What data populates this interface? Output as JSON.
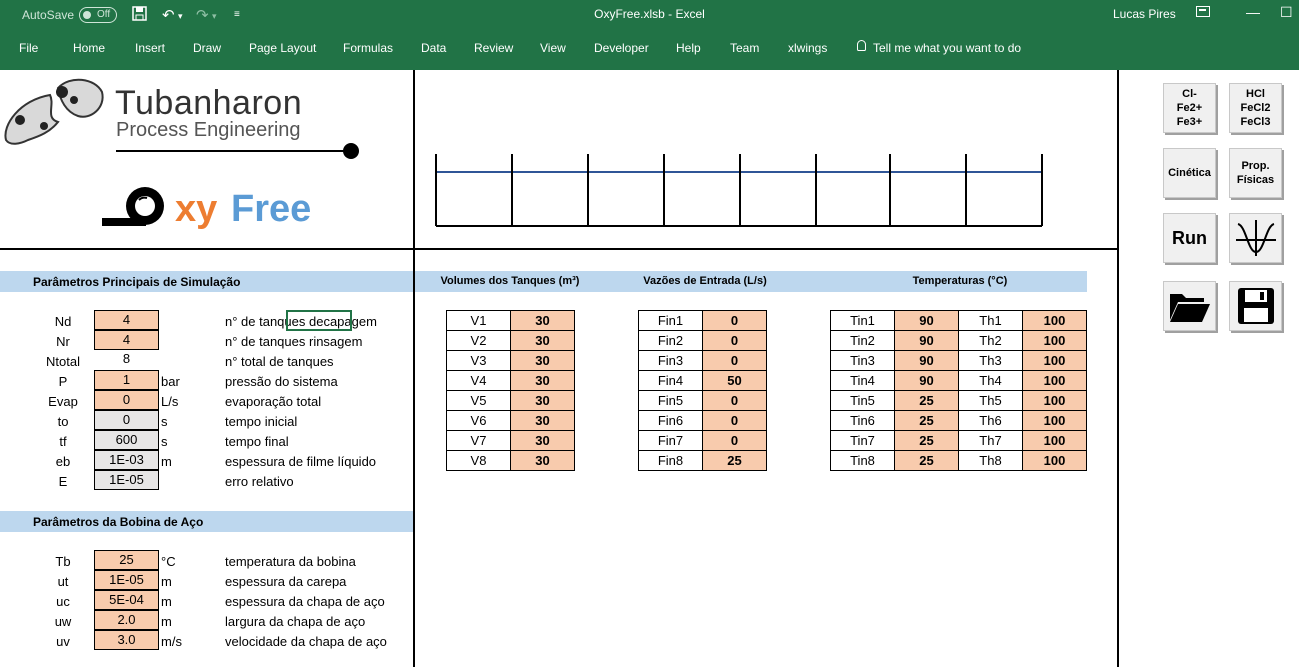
{
  "titlebar": {
    "autosave_label": "AutoSave",
    "autosave_state": "Off",
    "file_title": "OxyFree.xlsb  -  Excel",
    "user": "Lucas Pires"
  },
  "ribbon": {
    "tabs": [
      "File",
      "Home",
      "Insert",
      "Draw",
      "Page Layout",
      "Formulas",
      "Data",
      "Review",
      "View",
      "Developer",
      "Help",
      "Team",
      "xlwings"
    ],
    "tell_me": "Tell me what you want to do"
  },
  "logo": {
    "company_line1": "Tubanharon",
    "company_line2": "Process Engineering",
    "product_xy": "xy",
    "product_free": "Free"
  },
  "sim_params": {
    "header": "Parâmetros Principais de Simulação",
    "rows": [
      {
        "name": "Nd",
        "value": "4",
        "unit": "",
        "desc": "n° de tanques decapagem",
        "style": "orange"
      },
      {
        "name": "Nr",
        "value": "4",
        "unit": "",
        "desc": "n° de tanques rinsagem",
        "style": "orange"
      },
      {
        "name": "Ntotal",
        "value": "8",
        "unit": "",
        "desc": "n° total de tanques",
        "style": "plain"
      },
      {
        "name": "P",
        "value": "1",
        "unit": "bar",
        "desc": "pressão do sistema",
        "style": "orange"
      },
      {
        "name": "Evap",
        "value": "0",
        "unit": "L/s",
        "desc": "evaporação total",
        "style": "orange"
      },
      {
        "name": "to",
        "value": "0",
        "unit": "s",
        "desc": "tempo inicial",
        "style": "grey"
      },
      {
        "name": "tf",
        "value": "600",
        "unit": "s",
        "desc": "tempo final",
        "style": "grey"
      },
      {
        "name": "eb",
        "value": "1E-03",
        "unit": "m",
        "desc": "espessura de filme líquido",
        "style": "grey"
      },
      {
        "name": "E",
        "value": "1E-05",
        "unit": "",
        "desc": "erro relativo",
        "style": "grey"
      }
    ]
  },
  "coil_params": {
    "header": "Parâmetros da Bobina de Aço",
    "rows": [
      {
        "name": "Tb",
        "value": "25",
        "unit": "°C",
        "desc": "temperatura da bobina"
      },
      {
        "name": "ut",
        "value": "1E-05",
        "unit": "m",
        "desc": "espessura da carepa"
      },
      {
        "name": "uc",
        "value": "5E-04",
        "unit": "m",
        "desc": "espessura da chapa de aço"
      },
      {
        "name": "uw",
        "value": "2.0",
        "unit": "m",
        "desc": "largura da chapa de aço"
      },
      {
        "name": "uv",
        "value": "3.0",
        "unit": "m/s",
        "desc": "velocidade da chapa de aço"
      }
    ]
  },
  "tanks": {
    "headers": {
      "volumes": "Volumes dos Tanques (m³)",
      "flows": "Vazões de Entrada (L/s)",
      "temps": "Temperaturas (°C)"
    },
    "volumes": [
      [
        "V1",
        "30"
      ],
      [
        "V2",
        "30"
      ],
      [
        "V3",
        "30"
      ],
      [
        "V4",
        "30"
      ],
      [
        "V5",
        "30"
      ],
      [
        "V6",
        "30"
      ],
      [
        "V7",
        "30"
      ],
      [
        "V8",
        "30"
      ]
    ],
    "flows": [
      [
        "Fin1",
        "0"
      ],
      [
        "Fin2",
        "0"
      ],
      [
        "Fin3",
        "0"
      ],
      [
        "Fin4",
        "50"
      ],
      [
        "Fin5",
        "0"
      ],
      [
        "Fin6",
        "0"
      ],
      [
        "Fin7",
        "0"
      ],
      [
        "Fin8",
        "25"
      ]
    ],
    "temps_in": [
      [
        "Tin1",
        "90"
      ],
      [
        "Tin2",
        "90"
      ],
      [
        "Tin3",
        "90"
      ],
      [
        "Tin4",
        "90"
      ],
      [
        "Tin5",
        "25"
      ],
      [
        "Tin6",
        "25"
      ],
      [
        "Tin7",
        "25"
      ],
      [
        "Tin8",
        "25"
      ]
    ],
    "temps_h": [
      [
        "Th1",
        "100"
      ],
      [
        "Th2",
        "100"
      ],
      [
        "Th3",
        "100"
      ],
      [
        "Th4",
        "100"
      ],
      [
        "Th5",
        "100"
      ],
      [
        "Th6",
        "100"
      ],
      [
        "Th7",
        "100"
      ],
      [
        "Th8",
        "100"
      ]
    ]
  },
  "buttons": {
    "species1": [
      "Cl-",
      "Fe2+",
      "Fe3+"
    ],
    "species2": [
      "HCl",
      "FeCl2",
      "FeCl3"
    ],
    "kinetics": "Cinética",
    "props": [
      "Prop.",
      "Físicas"
    ],
    "run": "Run"
  },
  "colors": {
    "excel_green": "#217346",
    "input_orange": "#f8cbad",
    "header_blue": "#bdd7ee",
    "readonly_grey": "#e7e6e6"
  }
}
